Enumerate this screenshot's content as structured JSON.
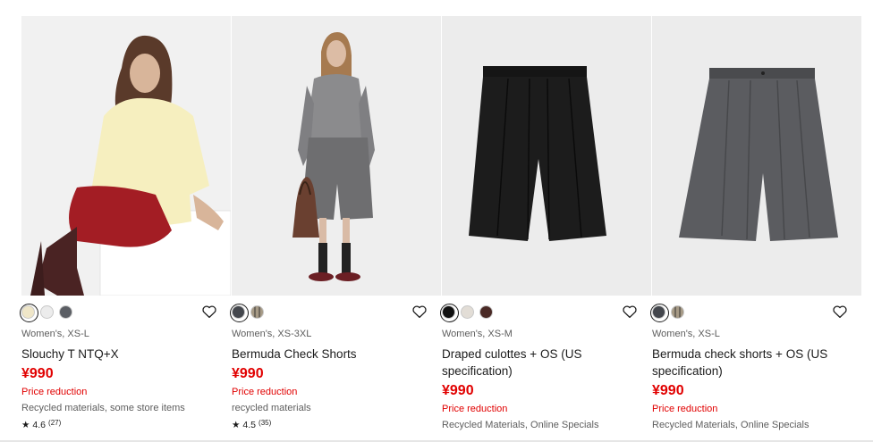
{
  "products": [
    {
      "meta": "Women's, XS-L",
      "name": "Slouchy T NTQ+X",
      "price": "¥990",
      "promo": "Price reduction",
      "features": "Recycled materials, some store items",
      "rating": "4.6",
      "review_count": "(27)",
      "swatch_colors": [
        "#efe6c8",
        "#ececec",
        "#5b5e64"
      ],
      "selected_swatch": 0
    },
    {
      "meta": "Women's, XS-3XL",
      "name": "Bermuda Check Shorts",
      "price": "¥990",
      "promo": "Price reduction",
      "features": "recycled materials",
      "rating": "4.5",
      "review_count": "(35)",
      "swatch_colors": [
        "#44474d",
        "#a69a86"
      ],
      "selected_swatch": 0
    },
    {
      "meta": "Women's, XS-M",
      "name": "Draped culottes + OS (US specification)",
      "price": "¥990",
      "promo": "Price reduction",
      "features": "Recycled Materials, Online Specials",
      "swatch_colors": [
        "#111111",
        "#e2ddd6",
        "#4a2a26"
      ],
      "selected_swatch": 0
    },
    {
      "meta": "Women's, XS-L",
      "name": "Bermuda check shorts + OS (US specification)",
      "price": "¥990",
      "promo": "Price reduction",
      "features": "Recycled Materials, Online Specials",
      "swatch_colors": [
        "#44474d",
        "#a69a86"
      ],
      "selected_swatch": 0
    }
  ],
  "icons": {
    "favorite": "heart-outline-icon",
    "star": "star-icon"
  },
  "colors": {
    "price": "#e10000",
    "text": "#1b1b1b",
    "muted": "#5d5d5d"
  }
}
